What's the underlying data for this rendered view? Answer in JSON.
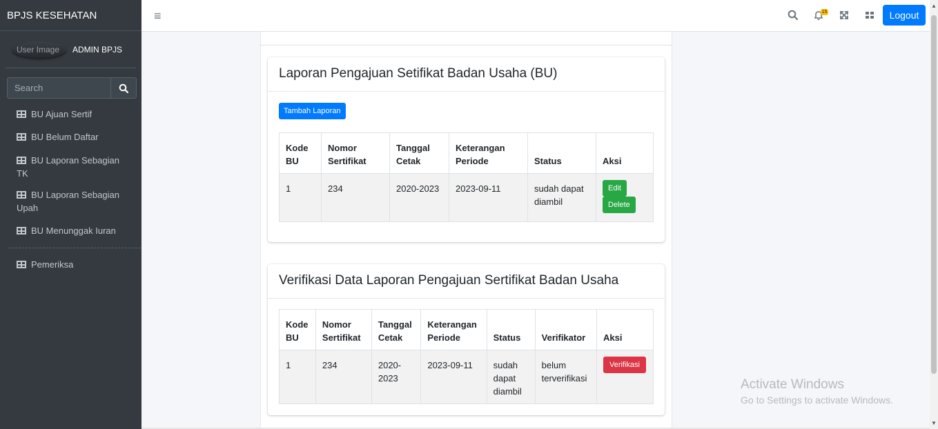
{
  "brand": "BPJS KESEHATAN",
  "user": {
    "avatar_alt": "User Image",
    "name": "ADMIN BPJS"
  },
  "search": {
    "placeholder": "Search"
  },
  "nav": [
    {
      "label": "BU Ajuan Sertif"
    },
    {
      "label": "BU Belum Daftar"
    },
    {
      "label": "BU Laporan Sebagian TK"
    },
    {
      "label": "BU Laporan Sebagian Upah"
    },
    {
      "label": "BU Menunggak Iuran"
    },
    {
      "label": "Pemeriksa"
    }
  ],
  "topbar": {
    "notification_count": "15",
    "logout_label": "Logout"
  },
  "card1": {
    "title": "Laporan Pengajuan Setifikat Badan Usaha (BU)",
    "add_label": "Tambah Laporan",
    "columns": [
      "Kode BU",
      "Nomor Sertifikat",
      "Tanggal Cetak",
      "Keterangan Periode",
      "Status",
      "Aksi"
    ],
    "rows": [
      {
        "kode": "1",
        "nomor": "234",
        "tanggal": "2020-2023",
        "periode": "2023-09-11",
        "status": "sudah dapat diambil",
        "edit": "Edit",
        "delete": "Delete"
      }
    ]
  },
  "card2": {
    "title": "Verifikasi Data Laporan Pengajuan Sertifikat Badan Usaha",
    "columns": [
      "Kode BU",
      "Nomor Sertifikat",
      "Tanggal Cetak",
      "Keterangan Periode",
      "Status",
      "Verifikator",
      "Aksi"
    ],
    "rows": [
      {
        "kode": "1",
        "nomor": "234",
        "tanggal": "2020-2023",
        "periode": "2023-09-11",
        "status": "sudah dapat diambil",
        "verifikator": "belum terverifikasi",
        "action": "Verifikasi"
      }
    ]
  },
  "watermark": {
    "title": "Activate Windows",
    "subtitle": "Go to Settings to activate Windows."
  },
  "colors": {
    "sidebar": "#343a40",
    "primary": "#007bff",
    "success": "#28a745",
    "danger": "#dc3545",
    "warning": "#ffc107"
  }
}
